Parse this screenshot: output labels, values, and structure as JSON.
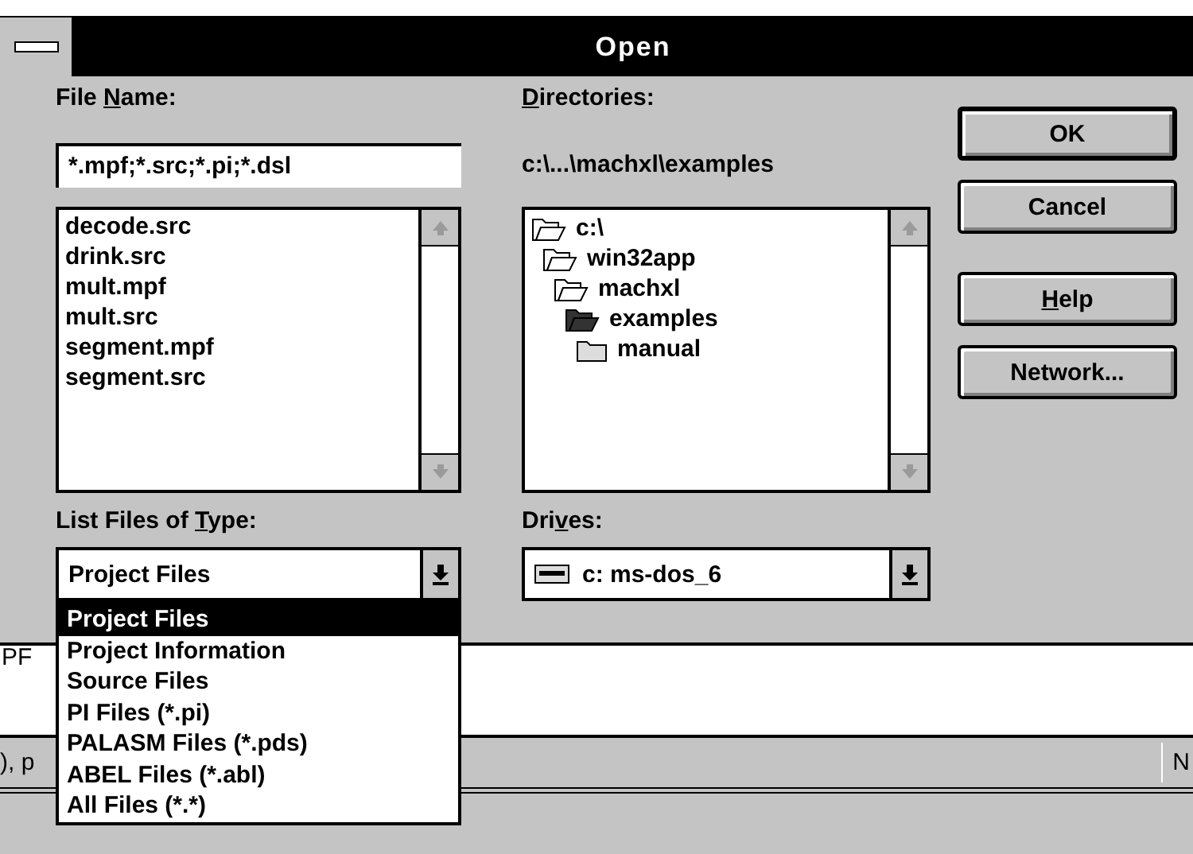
{
  "background_app": {
    "text_area": "PF",
    "status_bar": {
      "left": "), p",
      "right": "N"
    }
  },
  "window": {
    "title": "Open"
  },
  "file_name": {
    "label": {
      "pre": "File ",
      "key": "N",
      "post": "ame:"
    },
    "value": "*.mpf;*.src;*.pi;*.dsl"
  },
  "files": [
    {
      "name": "decode.src"
    },
    {
      "name": "drink.src"
    },
    {
      "name": "mult.mpf"
    },
    {
      "name": "mult.src"
    },
    {
      "name": "segment.mpf"
    },
    {
      "name": "segment.src"
    }
  ],
  "file_type": {
    "label": {
      "pre": "List Files of ",
      "key": "T",
      "post": "ype:"
    },
    "value": "Project Files",
    "expanded": true,
    "options": [
      {
        "label": "Project Files",
        "selected": true
      },
      {
        "label": "Project Information",
        "selected": false
      },
      {
        "label": "Source Files",
        "selected": false
      },
      {
        "label": "PI Files (*.pi)",
        "selected": false
      },
      {
        "label": "PALASM Files (*.pds)",
        "selected": false
      },
      {
        "label": "ABEL Files (*.abl)",
        "selected": false
      },
      {
        "label": "All Files (*.*)",
        "selected": false
      }
    ]
  },
  "directories": {
    "label": {
      "key": "D",
      "post": "irectories:"
    },
    "path": "c:\\...\\machxl\\examples",
    "tree": [
      {
        "name": "c:\\",
        "kind": "open",
        "children": [
          {
            "name": "win32app",
            "kind": "open",
            "children": [
              {
                "name": "machxl",
                "kind": "open",
                "children": [
                  {
                    "name": "examples",
                    "kind": "current",
                    "children": [
                      {
                        "name": "manual",
                        "kind": "closed"
                      }
                    ]
                  }
                ]
              }
            ]
          }
        ]
      }
    ]
  },
  "drives": {
    "label": {
      "pre": "Dri",
      "key": "v",
      "post": "es:"
    },
    "value": "c: ms-dos_6"
  },
  "buttons": [
    {
      "label": {
        "post": "OK"
      },
      "default": true
    },
    {
      "label": {
        "post": "Cancel"
      },
      "default": false
    },
    {
      "label": {
        "key": "H",
        "post": "elp"
      },
      "default": false
    },
    {
      "label": {
        "post": "Network..."
      },
      "default": false
    }
  ]
}
